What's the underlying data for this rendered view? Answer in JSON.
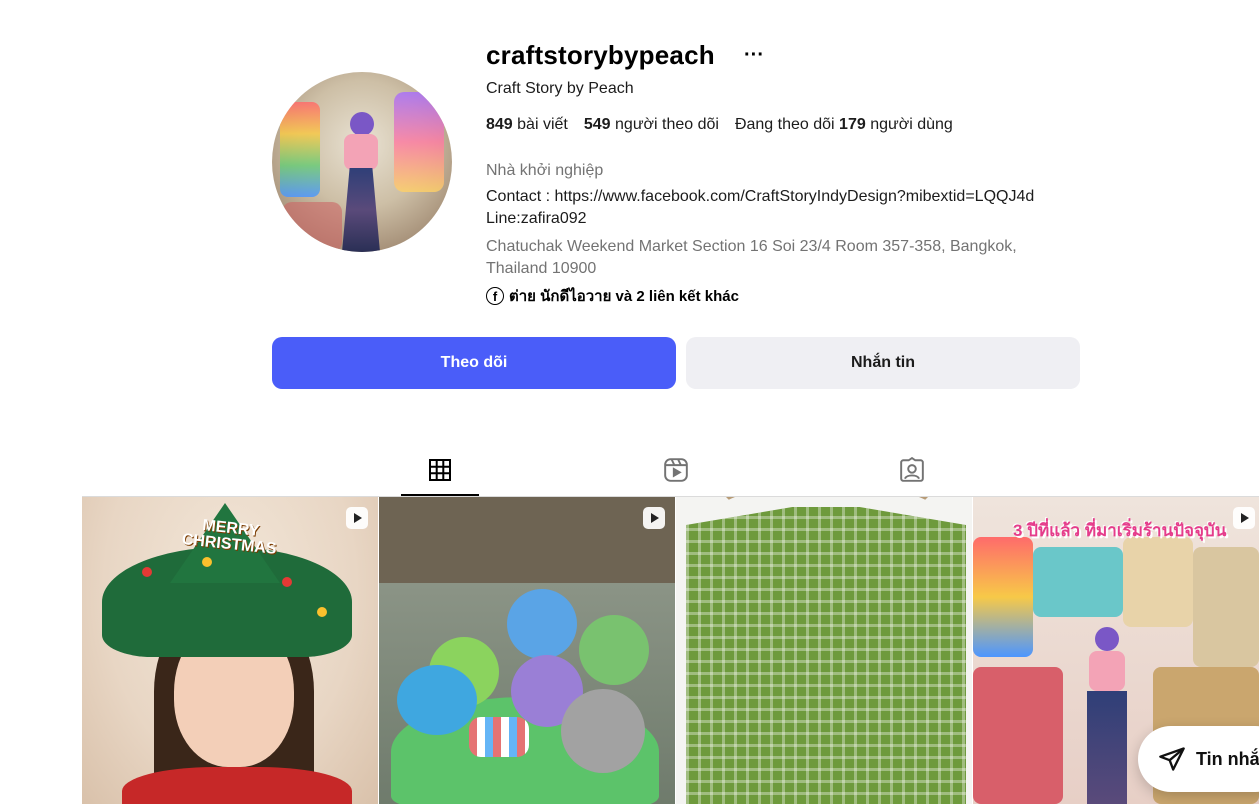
{
  "profile": {
    "username": "craftstorybypeach",
    "more_label": "···",
    "full_name": "Craft Story by Peach",
    "stats": {
      "posts_count": "849",
      "posts_label": "bài viết",
      "followers_count": "549",
      "followers_label": "người theo dõi",
      "following_prefix": "Đang theo dõi",
      "following_count": "179",
      "following_label": "người dùng"
    },
    "category": "Nhà khởi nghiệp",
    "bio_line1": "Contact : https://www.facebook.com/CraftStoryIndyDesign?mibextid=LQQJ4d",
    "bio_line2": "Line:zafira092",
    "address": "Chatuchak Weekend Market Section 16 Soi 23/4 Room 357-358, Bangkok, Thailand 10900",
    "links_text": "ต่าย นักดีไอวาย và 2 liên kết khác",
    "link_icon": "facebook-icon"
  },
  "actions": {
    "follow_label": "Theo dõi",
    "message_label": "Nhắn tin"
  },
  "tabs": [
    {
      "name": "posts",
      "icon": "grid-icon",
      "active": true
    },
    {
      "name": "reels",
      "icon": "reels-icon",
      "active": false
    },
    {
      "name": "tagged",
      "icon": "tagged-icon",
      "active": false
    }
  ],
  "grid": {
    "tile1_hat_text": "MERRY CHRISTMAS",
    "tile4_caption": "3 ปีที่แล้ว ที่มาเริ่มร้านปัจจุบัน"
  },
  "floating": {
    "messages_label": "Tin nhắn"
  },
  "colors": {
    "primary_button": "#4a5df9",
    "secondary_button": "#efeff3",
    "muted_text": "#737373"
  }
}
